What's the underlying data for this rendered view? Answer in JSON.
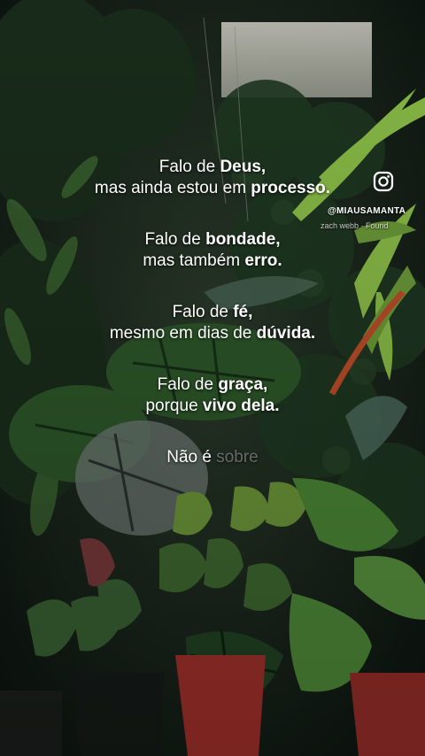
{
  "quote": {
    "s1": {
      "a": "Falo de ",
      "a_bold": "Deus,",
      "b": "mas ainda estou em ",
      "b_bold": "processo."
    },
    "s2": {
      "a": "Falo de ",
      "a_bold": "bondade,",
      "b": "mas também ",
      "b_bold": "erro."
    },
    "s3": {
      "a": "Falo de ",
      "a_bold": "fé,",
      "b": "mesmo em dias de ",
      "b_bold": "dúvida."
    },
    "s4": {
      "a": "Falo de ",
      "a_bold": "graça,",
      "b": "porque ",
      "b_bold": "vivo dela."
    },
    "fading": {
      "visible": "Não é ",
      "faint": "sobre"
    }
  },
  "watermark": {
    "icon": "instagram-icon",
    "handle": "@MIAUSAMANTA",
    "music": "zach webb · Found"
  },
  "colors": {
    "text": "#ffffff",
    "foliage_dark": "#14201a",
    "foliage_mid": "#2f5a2e",
    "foliage_light": "#8fc44a",
    "pot_red": "#a4312b"
  }
}
